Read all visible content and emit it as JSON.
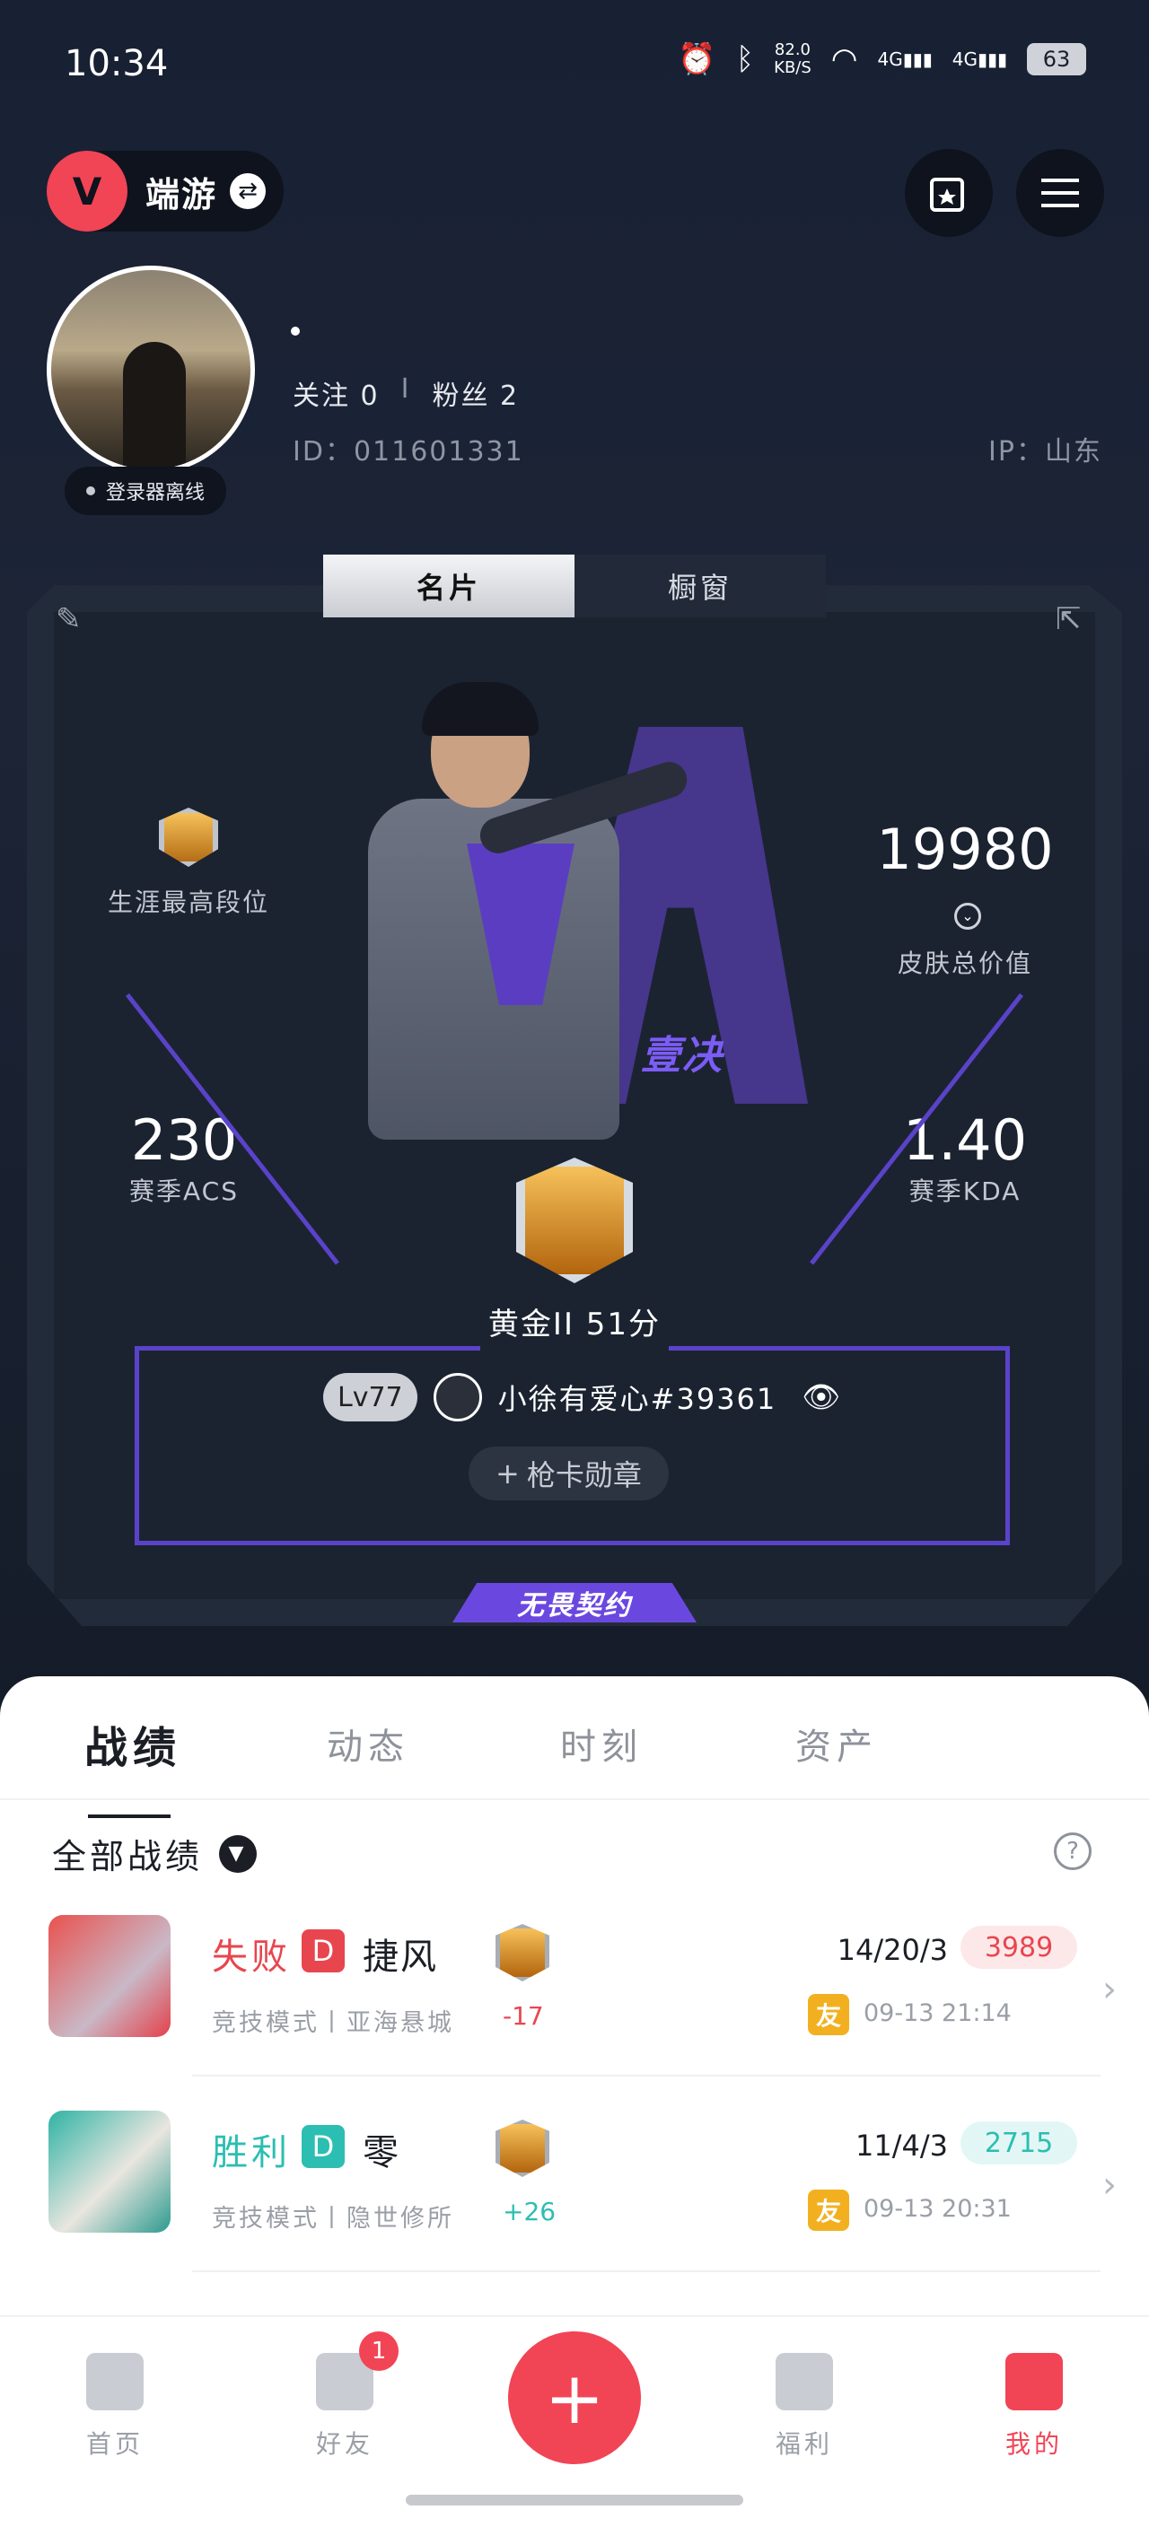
{
  "status_bar": {
    "time": "10:34",
    "speed": "82.0",
    "speed_unit": "KB/S",
    "net1": "4G",
    "net2": "4G",
    "battery": "63"
  },
  "header": {
    "brand_name": "端游",
    "brand_logo_icon": "valorant-logo-icon",
    "swap_icon": "swap-icon",
    "wallet_icon": "card-star-icon",
    "menu_icon": "hamburger-menu-icon"
  },
  "profile": {
    "nickname": "•",
    "follow_label": "关注",
    "follow_count": "0",
    "divider": "I",
    "fans_label": "粉丝",
    "fans_count": "2",
    "id_text": "ID：011601331",
    "ip_text": "IP：山东",
    "status": "登录器离线"
  },
  "card_tabs": [
    {
      "label": "名片",
      "active": true
    },
    {
      "label": "橱窗",
      "active": false
    }
  ],
  "card": {
    "career_rank_label": "生涯最高段位",
    "skin_value": "19980",
    "skin_value_label": "皮肤总价值",
    "acs_value": "230",
    "acs_label": "赛季ACS",
    "kda_value": "1.40",
    "kda_label": "赛季KDA",
    "agent_tag": "壹决",
    "current_rank": "黄金II 51分",
    "level": "Lv77",
    "player_name": "小徐有爱心#39361",
    "medal_button": "枪卡勋章",
    "contract_banner": "无畏契约",
    "accent": "#5a43c9"
  },
  "content_tabs": [
    {
      "label": "战绩",
      "active": true
    },
    {
      "label": "动态",
      "active": false
    },
    {
      "label": "时刻",
      "active": false
    },
    {
      "label": "资产",
      "active": false
    }
  ],
  "filter": {
    "label": "全部战绩"
  },
  "matches": [
    {
      "result": "失败",
      "result_color": "#e8464f",
      "badge": "D",
      "badge_color": "#e8464f",
      "agent": "捷风",
      "mode": "竞技模式丨亚海悬城",
      "delta": "-17",
      "delta_color": "#e8464f",
      "kda": "14/20/3",
      "acs": "3989",
      "acs_bg": "#fde8e9",
      "acs_color": "#e8464f",
      "friend": "友",
      "time": "09-13 21:14"
    },
    {
      "result": "胜利",
      "result_color": "#2cbeb2",
      "badge": "D",
      "badge_color": "#2cbeb2",
      "agent": "零",
      "mode": "竞技模式丨隐世修所",
      "delta": "+26",
      "delta_color": "#2cbeb2",
      "kda": "11/4/3",
      "acs": "2715",
      "acs_bg": "#e2f7f5",
      "acs_color": "#2cbeb2",
      "friend": "友",
      "time": "09-13 20:31"
    }
  ],
  "bottom_nav": [
    {
      "label": "首页",
      "icon": "home-icon",
      "active": false
    },
    {
      "label": "好友",
      "icon": "friends-icon",
      "active": false,
      "badge": "1"
    },
    {
      "label": "",
      "icon": "plus-icon",
      "active": false
    },
    {
      "label": "福利",
      "icon": "gift-icon",
      "active": false
    },
    {
      "label": "我的",
      "icon": "profile-icon",
      "active": true
    }
  ],
  "colors": {
    "brand": "#f14455",
    "bg": "#161d2b",
    "win": "#2cbeb2",
    "loss": "#e8464f"
  }
}
